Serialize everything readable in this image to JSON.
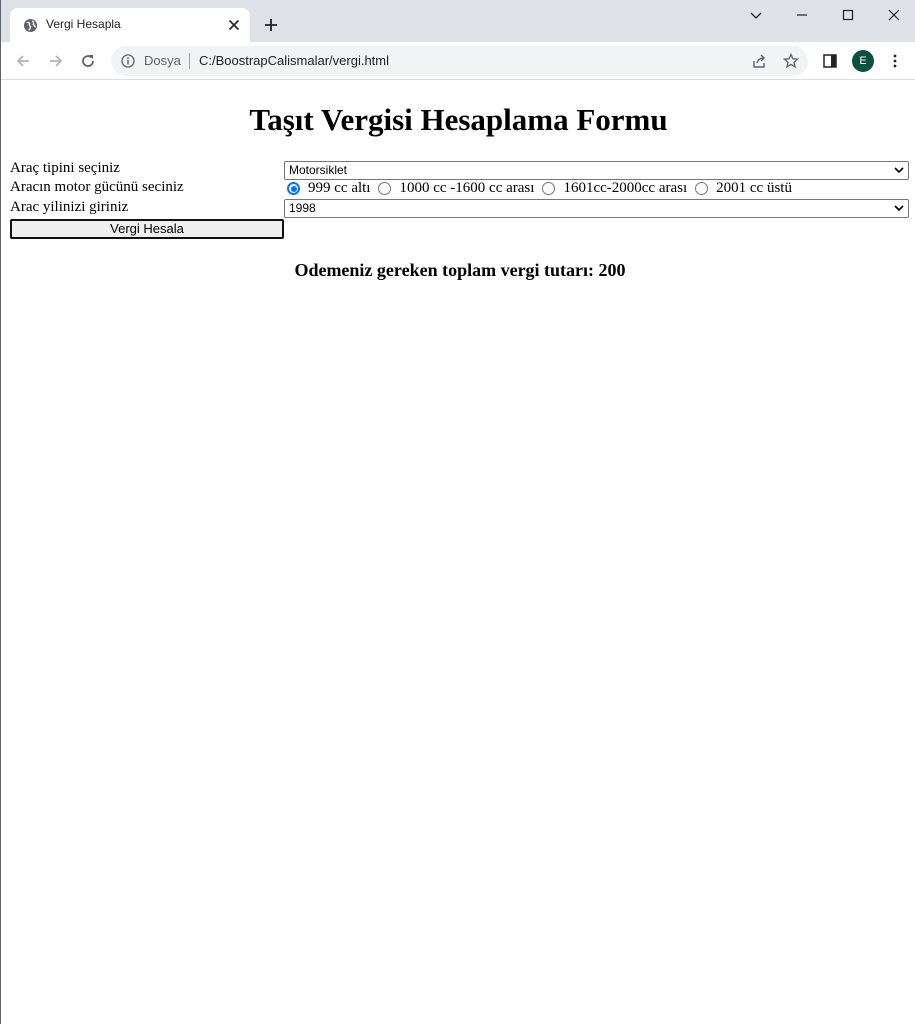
{
  "browser": {
    "tab_title": "Vergi Hesapla",
    "url_scheme": "Dosya",
    "url": "C:/BoostrapCalismalar/vergi.html",
    "profile_initial": "E"
  },
  "page": {
    "title": "Taşıt Vergisi Hesaplama Formu",
    "vehicle_type_label": "Araç tipini seçiniz",
    "vehicle_type_value": "Motorsiklet",
    "engine_label": "Aracın motor gücünü seciniz",
    "engine_options": [
      {
        "label": "999 cc altı",
        "selected": true
      },
      {
        "label": "1000 cc -1600 cc arası",
        "selected": false
      },
      {
        "label": "1601cc-2000cc arası",
        "selected": false
      },
      {
        "label": "2001 cc üstü",
        "selected": false
      }
    ],
    "year_label": "Arac yilinizi giriniz",
    "year_value": "1998",
    "calculate_button": "Vergi Hesala",
    "result_text": "Odemeniz gereken toplam vergi tutarı: 200"
  },
  "colors": {
    "tabstrip_bg": "#dee1e6",
    "omnibox_bg": "#f1f3f4",
    "avatar_bg": "#0b5140",
    "radio_accent": "#0075ff"
  }
}
